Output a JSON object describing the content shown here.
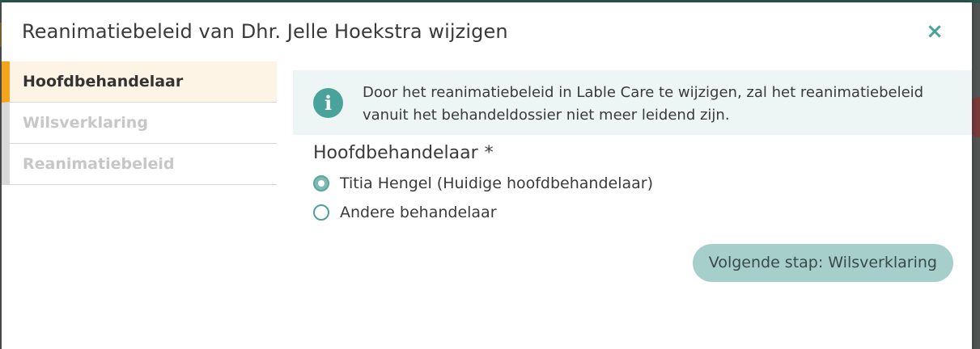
{
  "modal": {
    "title": "Reanimatiebeleid van Dhr. Jelle Hoekstra wijzigen",
    "close_icon": "×"
  },
  "steps": [
    {
      "label": "Hoofdbehandelaar",
      "active": true
    },
    {
      "label": "Wilsverklaring",
      "active": false
    },
    {
      "label": "Reanimatiebeleid",
      "active": false
    }
  ],
  "info": {
    "icon": "i",
    "text": "Door het reanimatiebeleid in Lable Care te wijzigen, zal het reanimatiebeleid vanuit het behandeldossier niet meer leidend zijn."
  },
  "form": {
    "label": "Hoofdbehandelaar",
    "required_marker": "*",
    "options": [
      {
        "label": "Titia Hengel (Huidige hoofdbehandelaar)",
        "checked": true
      },
      {
        "label": "Andere behandelaar",
        "checked": false
      }
    ],
    "next_label": "Volgende stap: Wilsverklaring"
  },
  "colors": {
    "accent": "#4aa39a",
    "active_step": "#f5a51c",
    "active_step_bg": "#fdf4e5",
    "info_bg": "#eef5f5",
    "button_bg": "#a6cfcb"
  }
}
